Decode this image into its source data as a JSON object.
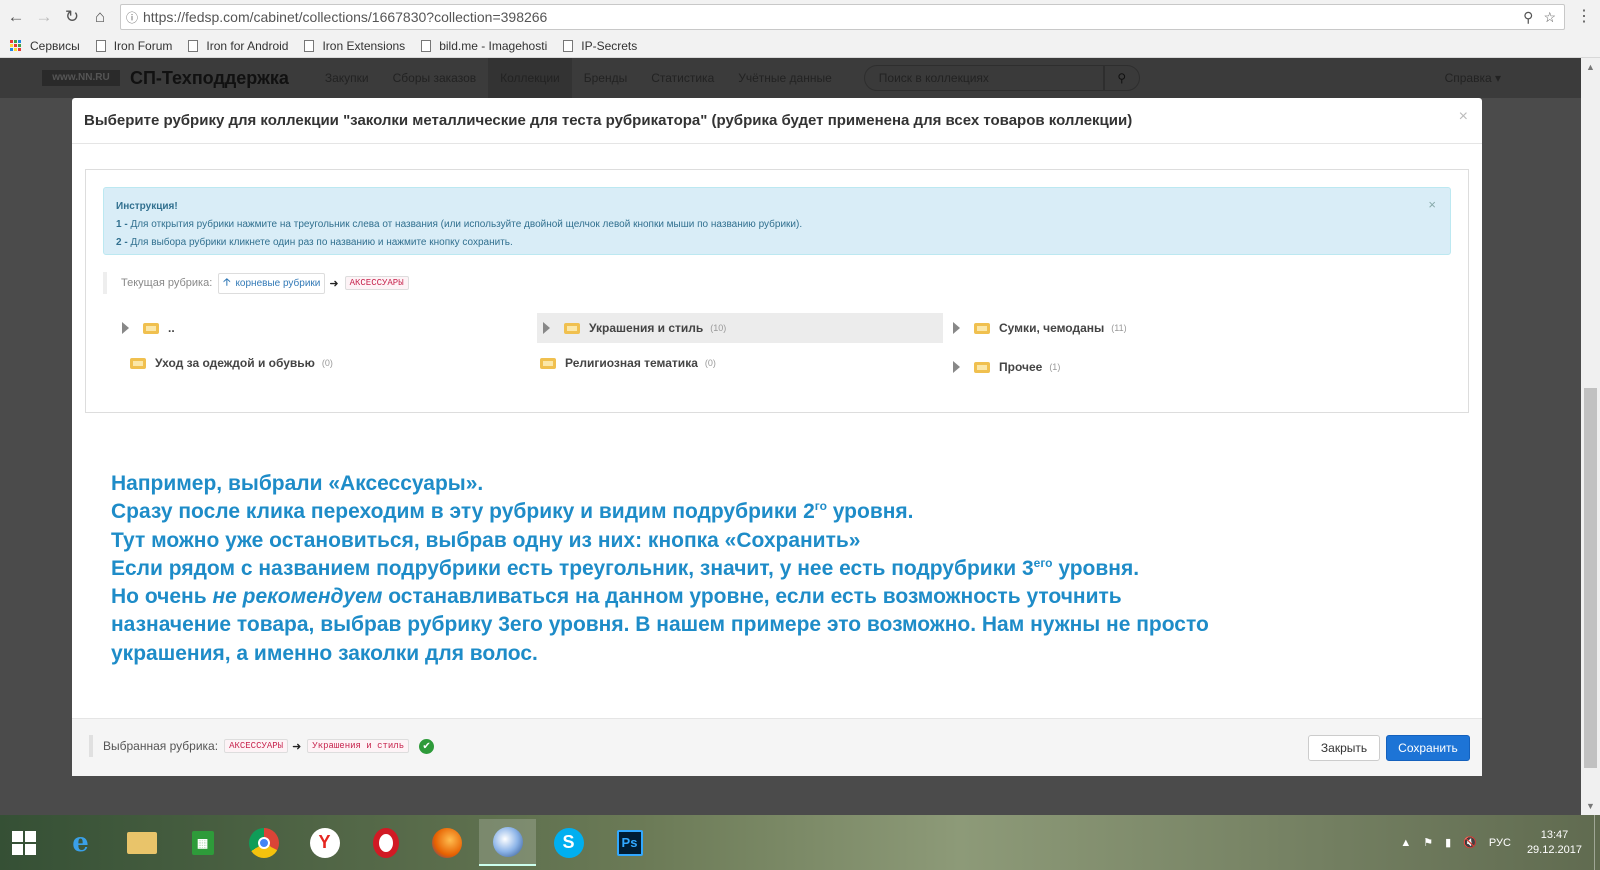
{
  "browser": {
    "url": "https://fedsp.com/cabinet/collections/1667830?collection=398266",
    "bookmarks": [
      "Сервисы",
      "Iron Forum",
      "Iron for Android",
      "Iron Extensions",
      "bild.me - Imagehosti",
      "IP-Secrets"
    ]
  },
  "site": {
    "logo": "www.NN.RU",
    "title": "СП-Техподдержка",
    "menu": [
      "Закупки",
      "Сборы заказов",
      "Коллекции",
      "Бренды",
      "Статистика",
      "Учётные данные"
    ],
    "search_placeholder": "Поиск в коллекциях",
    "help": "Справка ▾"
  },
  "modal": {
    "title": "Выберите рубрику для коллекции \"заколки металлические для теста рубрикатора\" (рубрика будет применена для всех товаров коллекции)",
    "instruction": {
      "title": "Инструкция!",
      "line1_num": "1 -",
      "line1": " Для открытия рубрики нажмите на треугольник слева от названия (или используйте двойной щелчок левой кнопки мыши по названию рубрики).",
      "line2_num": "2 -",
      "line2": " Для выбора рубрики кликнете один раз по названию и нажмите кнопку сохранить."
    },
    "current": {
      "label": "Текущая рубрика:",
      "root": "корневые рубрики",
      "selected": "АКСЕССУАРЫ"
    },
    "categories": [
      {
        "name": "..",
        "count": ""
      },
      {
        "name": "Украшения и стиль",
        "count": "(10)"
      },
      {
        "name": "Сумки, чемоданы",
        "count": "(11)"
      },
      {
        "name": "Уход за одеждой и обувью",
        "count": "(0)"
      },
      {
        "name": "Религиозная тематика",
        "count": "(0)"
      },
      {
        "name": "Прочее",
        "count": "(1)"
      }
    ],
    "note": {
      "l1": "Например, выбрали «Аксессуары».",
      "l2a": "Сразу после клика переходим в эту рубрику и видим подрубрики 2",
      "l2sup": "го",
      "l2b": " уровня.",
      "l3": "Тут можно уже остановиться, выбрав одну из них: кнопка «Сохранить»",
      "l4a": "Если рядом с названием подрубрики есть треугольник, значит, у нее есть подрубрики 3",
      "l4sup": "его",
      "l4b": " уровня.",
      "l5a": "Но очень ",
      "l5em": "не рекомендуем",
      "l5b": " останавливаться на данном уровне, если есть возможность уточнить",
      "l6": "назначение товара, выбрав рубрику 3его уровня. В нашем примере это возможно. Нам нужны не просто",
      "l7": "украшения, а именно заколки для волос."
    },
    "footer": {
      "label": "Выбранная рубрика:",
      "path1": "АКСЕССУАРЫ",
      "path2": "Украшения и стиль",
      "close": "Закрыть",
      "save": "Сохранить"
    }
  },
  "taskbar": {
    "lang": "РУС",
    "time": "13:47",
    "date": "29.12.2017"
  },
  "colors": {
    "accent_blue": "#1d74d6",
    "note_blue": "#1e8cc8",
    "alert_bg": "#d9edf7",
    "folder": "#f0c04f"
  }
}
